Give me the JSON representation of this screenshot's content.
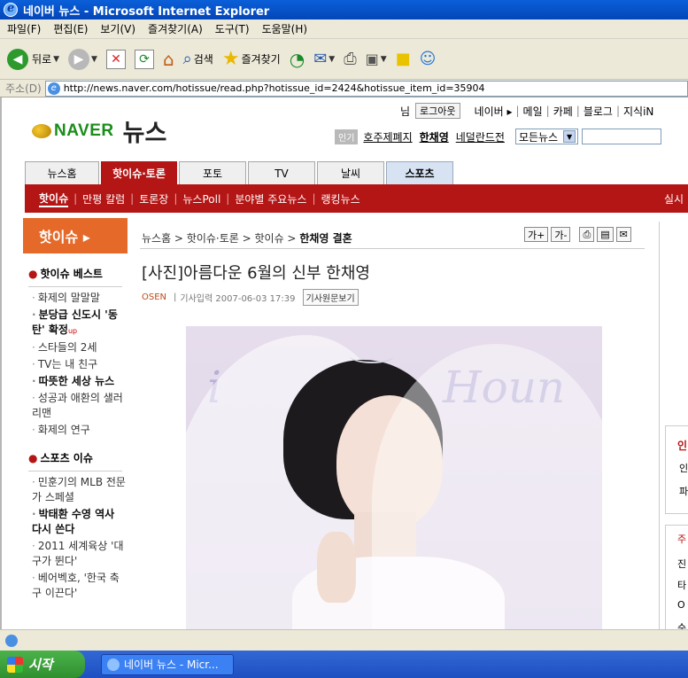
{
  "window": {
    "title": "네이버 뉴스 - Microsoft Internet Explorer"
  },
  "menu": [
    "파일(F)",
    "편집(E)",
    "보기(V)",
    "즐겨찾기(A)",
    "도구(T)",
    "도움말(H)"
  ],
  "toolbar": {
    "back_label": "뒤로",
    "search_label": "검색",
    "favorites_label": "즐겨찾기"
  },
  "address": {
    "label": "주소(D)",
    "url": "http://news.naver.com/hotissue/read.php?hotissue_id=2424&hotissue_item_id=35904"
  },
  "top_links": {
    "user_suffix": "님",
    "logout": "로그아웃",
    "links": [
      "네이버 ▸",
      "메일",
      "카페",
      "블로그",
      "지식iN"
    ]
  },
  "logo": {
    "naver": "NAVER",
    "news": "뉴스"
  },
  "hot_keywords": {
    "badge": "인기",
    "items": [
      "호주제폐지",
      "한채영",
      "네덜란드전"
    ],
    "select_value": "모든뉴스"
  },
  "tabs": [
    "뉴스홈",
    "핫이슈·토론",
    "포토",
    "TV",
    "날씨",
    "스포츠"
  ],
  "subnav": {
    "items": [
      "핫이슈",
      "만평 칼럼",
      "토론장",
      "뉴스Poll",
      "분야별 주요뉴스",
      "랭킹뉴스"
    ],
    "right": "실시"
  },
  "sidebar": {
    "header": "핫이슈 ▸",
    "sections": [
      {
        "title": "핫이슈 베스트",
        "items": [
          {
            "text": "화제의 말말말",
            "bold": false
          },
          {
            "text": "분당급 신도시 '동탄' 확정",
            "bold": true,
            "up": "up"
          },
          {
            "text": "스타들의 2세",
            "bold": false
          },
          {
            "text": "TV는 내 친구",
            "bold": false
          },
          {
            "text": "따뜻한 세상 뉴스",
            "bold": true
          },
          {
            "text": "성공과 애환의 샐러리맨",
            "bold": false
          },
          {
            "text": "화제의 연구",
            "bold": false
          }
        ]
      },
      {
        "title": "스포츠 이슈",
        "items": [
          {
            "text": "민훈기의 MLB 전문가 스페셜",
            "bold": false
          },
          {
            "text": "박태환 수영 역사 다시 쓴다",
            "bold": true
          },
          {
            "text": "2011 세계육상 '대구가 뛴다'",
            "bold": false
          },
          {
            "text": "베어벡호, '한국 축구 이끈다'",
            "bold": false
          }
        ]
      }
    ]
  },
  "breadcrumb": {
    "path": "뉴스홈 > 핫이슈·토론 > 핫이슈 > ",
    "current": "한채영 결혼"
  },
  "article_tools": [
    "가+",
    "가-",
    "⎙",
    "▤",
    "✉"
  ],
  "article": {
    "title": "[사진]아름다운 6월의 신부 한채영",
    "source": "OSEN",
    "date": "기사입력 2007-06-03 17:39",
    "original_button": "기사원문보기",
    "photo_bg_text_left": "i",
    "photo_bg_text_right": "Houn"
  },
  "right_panel": {
    "title_frag": "인",
    "lines": [
      "인",
      "파",
      "주",
      "진",
      "타",
      "O",
      "순"
    ]
  },
  "taskbar": {
    "start": "시작",
    "task": "네이버 뉴스 - Micr..."
  }
}
